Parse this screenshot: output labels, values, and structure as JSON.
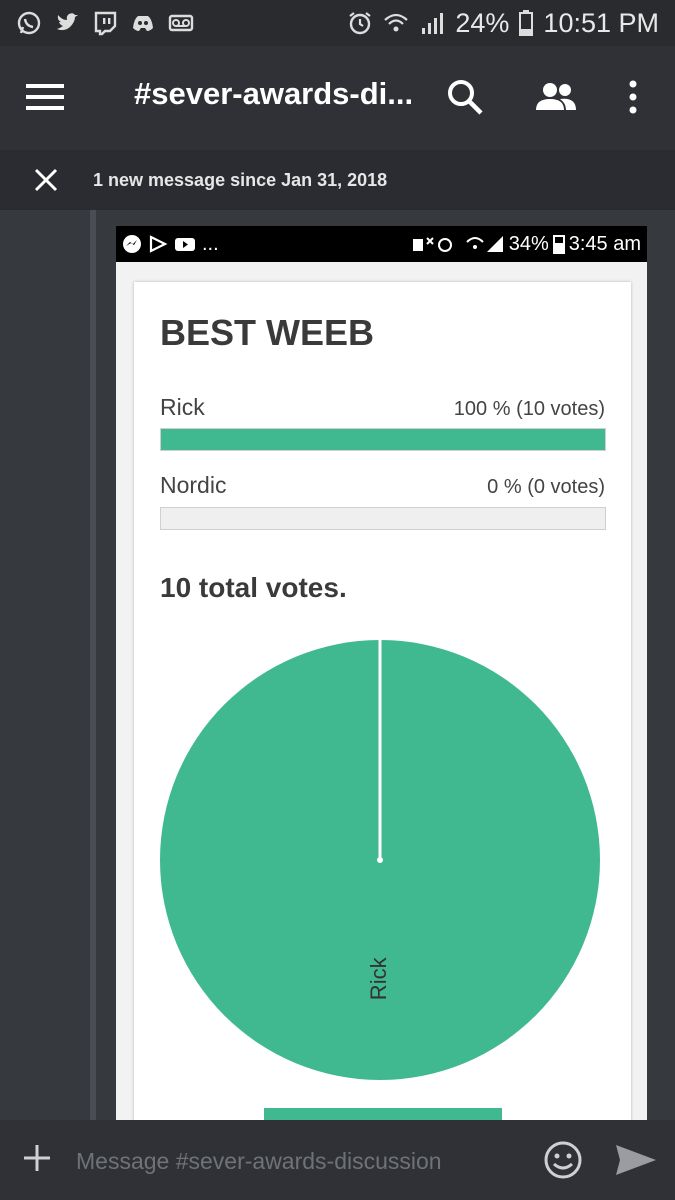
{
  "status_bar": {
    "icons_left": [
      "whatsapp-icon",
      "twitter-icon",
      "twitch-icon",
      "discord-icon",
      "voicemail-icon"
    ],
    "battery": "24%",
    "time": "10:51 PM"
  },
  "app_bar": {
    "channel_title": "#sever-awards-di..."
  },
  "new_messages": {
    "text": "1 new message since Jan 31, 2018"
  },
  "attachment": {
    "status_bar": {
      "left_text": "...",
      "battery": "34%",
      "time": "3:45 am"
    },
    "poll": {
      "title": "BEST WEEB",
      "options": [
        {
          "label": "Rick",
          "stat": "100 % (10 votes)",
          "fraction": 1.0
        },
        {
          "label": "Nordic",
          "stat": "0 % (0 votes)",
          "fraction": 0.0
        }
      ],
      "total": "10 total votes."
    },
    "chart_data": {
      "type": "pie",
      "categories": [
        "Rick",
        "Nordic"
      ],
      "values": [
        10,
        0
      ],
      "colors": [
        "#41b990",
        "#e0e0e0"
      ]
    }
  },
  "composer": {
    "placeholder": "Message #sever-awards-discussion"
  },
  "colors": {
    "accent": "#41b990",
    "background": "#36393e",
    "header": "#2f3136"
  }
}
